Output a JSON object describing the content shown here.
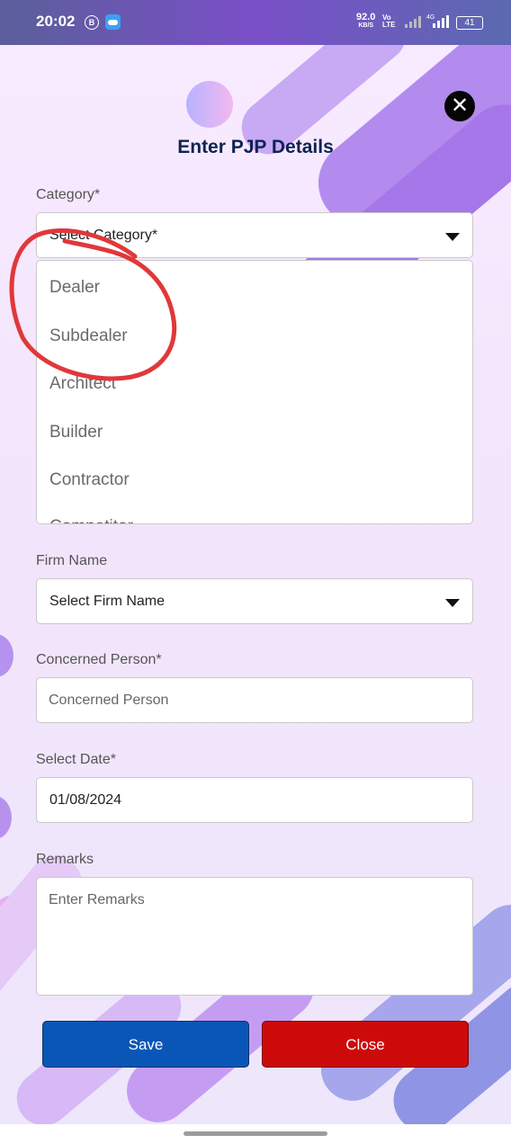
{
  "status_bar": {
    "time": "20:02",
    "b_icon": "B",
    "speed_value": "92.0",
    "speed_unit": "KB/S",
    "volte_line1": "Vo",
    "volte_line2": "LTE",
    "net_label": "4G",
    "battery": "41"
  },
  "dialog": {
    "title": "Enter PJP Details",
    "close_icon": "close-icon"
  },
  "category": {
    "label": "Category*",
    "selected": "Select Category*",
    "options": [
      "Dealer",
      "Subdealer",
      "Architect",
      "Builder",
      "Contractor",
      "Competitor"
    ]
  },
  "firm": {
    "label": "Firm Name",
    "selected": "Select Firm Name"
  },
  "person": {
    "label": "Concerned Person*",
    "placeholder": "Concerned Person"
  },
  "date": {
    "label": "Select Date*",
    "value": "01/08/2024"
  },
  "remarks": {
    "label": "Remarks",
    "placeholder": "Enter Remarks"
  },
  "buttons": {
    "save": "Save",
    "close": "Close"
  },
  "colors": {
    "title": "#0f2350",
    "save": "#0a56b6",
    "close": "#cd0a0a",
    "annotation": "#e0383a"
  }
}
